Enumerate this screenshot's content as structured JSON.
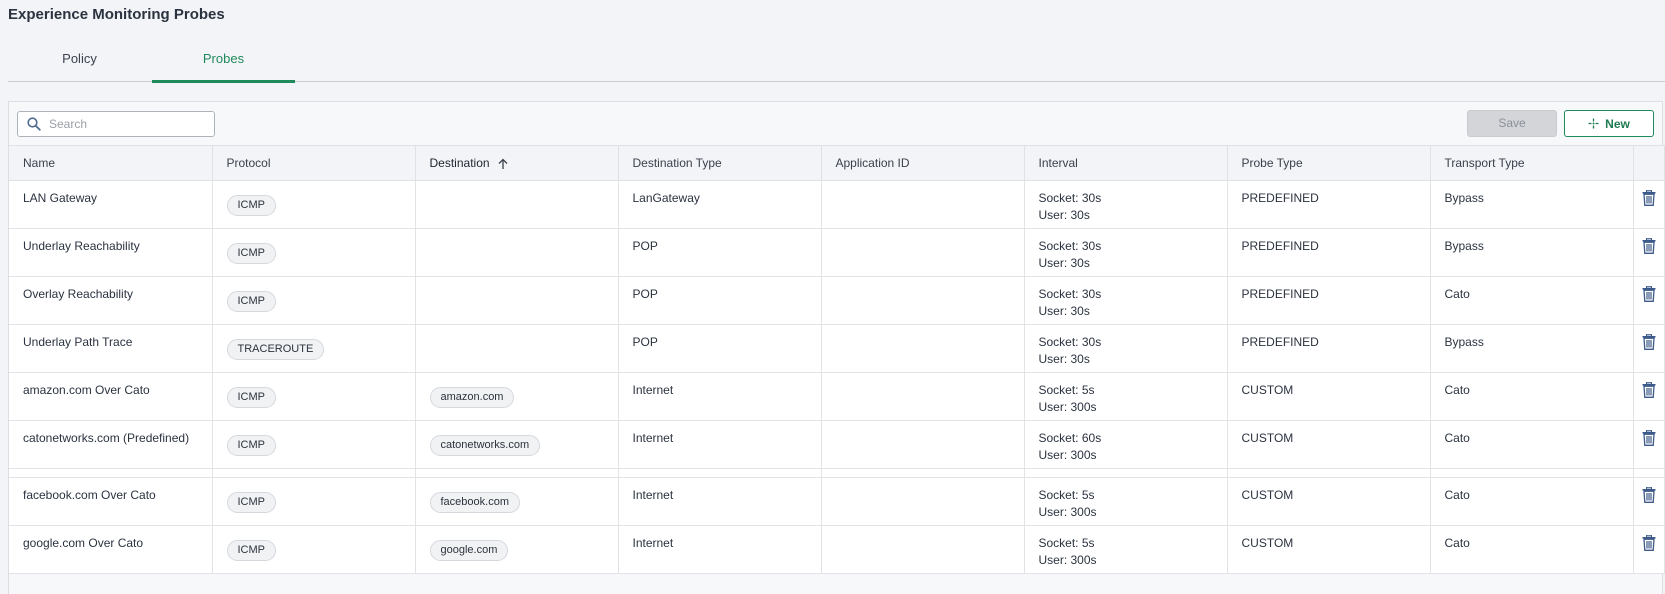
{
  "page": {
    "title": "Experience Monitoring Probes"
  },
  "tabs": [
    {
      "label": "Policy",
      "active": false
    },
    {
      "label": "Probes",
      "active": true
    }
  ],
  "toolbar": {
    "search_placeholder": "Search",
    "save_label": "Save",
    "new_label": "New"
  },
  "columns": [
    "Name",
    "Protocol",
    "Destination",
    "Destination Type",
    "Application ID",
    "Interval",
    "Probe Type",
    "Transport Type"
  ],
  "sort": {
    "column": "Destination",
    "direction": "ascending"
  },
  "rows": [
    {
      "name": "LAN Gateway",
      "protocol": "ICMP",
      "destination": "",
      "destination_type": "LanGateway",
      "application_id": "",
      "interval_socket": "Socket: 30s",
      "interval_user": "User: 30s",
      "probe_type": "PREDEFINED",
      "transport_type": "Bypass"
    },
    {
      "name": "Underlay Reachability",
      "protocol": "ICMP",
      "destination": "",
      "destination_type": "POP",
      "application_id": "",
      "interval_socket": "Socket: 30s",
      "interval_user": "User: 30s",
      "probe_type": "PREDEFINED",
      "transport_type": "Bypass"
    },
    {
      "name": "Overlay Reachability",
      "protocol": "ICMP",
      "destination": "",
      "destination_type": "POP",
      "application_id": "",
      "interval_socket": "Socket: 30s",
      "interval_user": "User: 30s",
      "probe_type": "PREDEFINED",
      "transport_type": "Cato"
    },
    {
      "name": "Underlay Path Trace",
      "protocol": "TRACEROUTE",
      "destination": "",
      "destination_type": "POP",
      "application_id": "",
      "interval_socket": "Socket: 30s",
      "interval_user": "User: 30s",
      "probe_type": "PREDEFINED",
      "transport_type": "Bypass"
    },
    {
      "name": "amazon.com Over Cato",
      "protocol": "ICMP",
      "destination": "amazon.com",
      "destination_type": "Internet",
      "application_id": "",
      "interval_socket": "Socket: 5s",
      "interval_user": "User: 300s",
      "probe_type": "CUSTOM",
      "transport_type": "Cato"
    },
    {
      "name": "catonetworks.com (Predefined)",
      "protocol": "ICMP",
      "destination": "catonetworks.com",
      "destination_type": "Internet",
      "application_id": "",
      "interval_socket": "Socket: 60s",
      "interval_user": "User: 300s",
      "probe_type": "CUSTOM",
      "transport_type": "Cato"
    },
    {
      "name": "facebook.com Over Cato",
      "protocol": "ICMP",
      "destination": "facebook.com",
      "destination_type": "Internet",
      "application_id": "",
      "interval_socket": "Socket: 5s",
      "interval_user": "User: 300s",
      "probe_type": "CUSTOM",
      "transport_type": "Cato"
    },
    {
      "name": "google.com Over Cato",
      "protocol": "ICMP",
      "destination": "google.com",
      "destination_type": "Internet",
      "application_id": "",
      "interval_socket": "Socket: 5s",
      "interval_user": "User: 300s",
      "probe_type": "CUSTOM",
      "transport_type": "Cato"
    }
  ],
  "colors": {
    "accent": "#1f8a5b",
    "trash_icon": "#3d5a8a",
    "save_disabled": "#d3d5d9"
  },
  "icons": {
    "search": "search-icon",
    "new": "plus-icon",
    "delete": "trash-icon",
    "sort": "arrow-up-icon"
  }
}
